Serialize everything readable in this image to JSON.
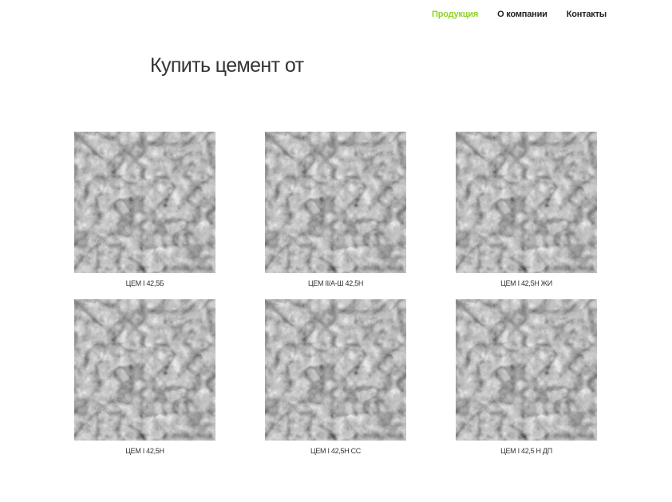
{
  "nav": {
    "items": [
      {
        "label": "Продукция",
        "active": true
      },
      {
        "label": "О компании",
        "active": false
      },
      {
        "label": "Контакты",
        "active": false
      }
    ]
  },
  "hero": {
    "title": "Купить цемент от"
  },
  "products": [
    {
      "name": "ЦЕМ I 42,5Б",
      "image": "cement-powder-image"
    },
    {
      "name": "ЦЕМ II/А-Ш 42,5Н",
      "image": "cement-powder-image"
    },
    {
      "name": "ЦЕМ I 42,5Н ЖИ",
      "image": "cement-powder-image"
    },
    {
      "name": "ЦЕМ I 42,5Н",
      "image": "cement-powder-image"
    },
    {
      "name": "ЦЕМ I 42,5Н СС",
      "image": "cement-powder-image"
    },
    {
      "name": "ЦЕМ I 42,5 Н ДП",
      "image": "cement-powder-image"
    }
  ],
  "colors": {
    "nav_active": "#8fd12a",
    "nav_text": "#222222",
    "title_text": "#333333"
  }
}
